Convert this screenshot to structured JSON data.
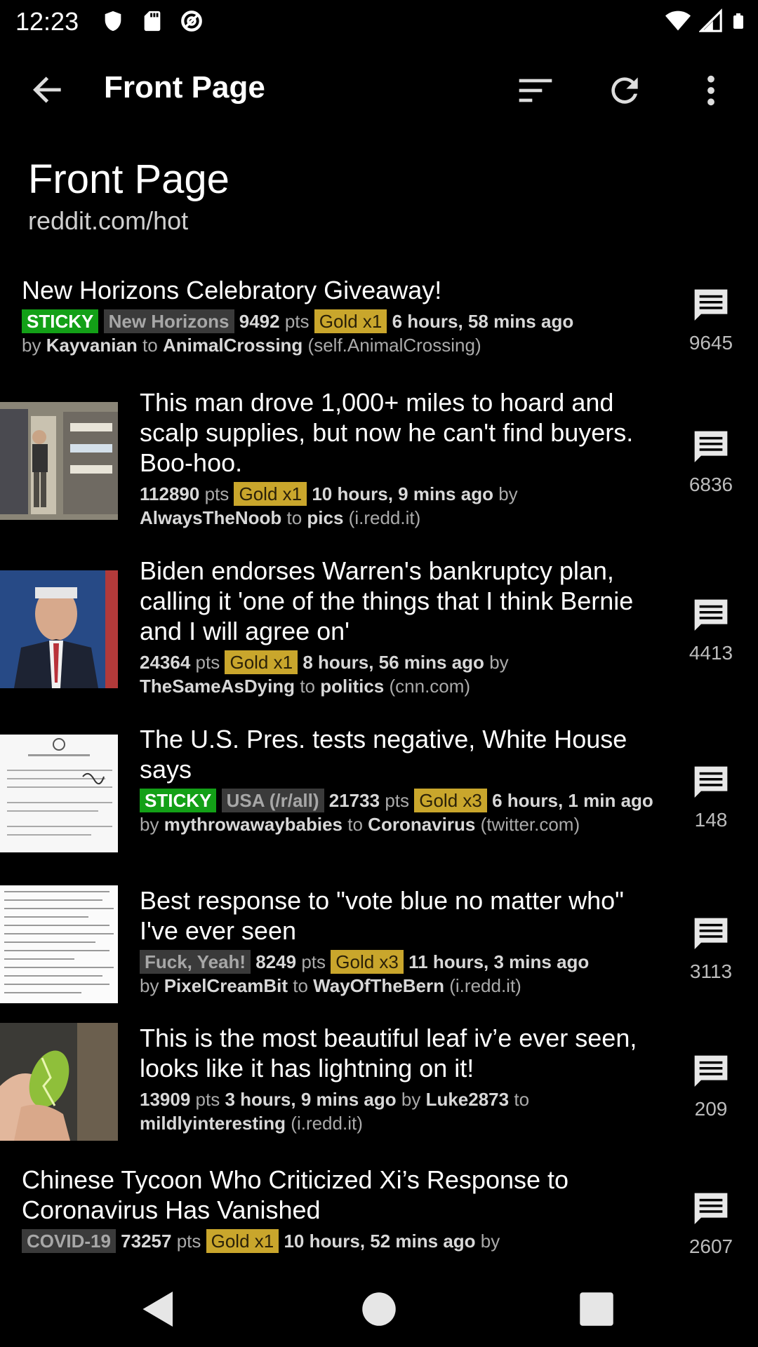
{
  "status_bar": {
    "time": "12:23"
  },
  "toolbar": {
    "title": "Front Page"
  },
  "header": {
    "title": "Front Page",
    "subtitle": "reddit.com/hot"
  },
  "posts": [
    {
      "title": "New Horizons Celebratory Giveaway!",
      "sticky": "STICKY",
      "flair": "New Horizons",
      "points": "9492",
      "pts_label": "pts",
      "gold": "Gold x1",
      "time": "6 hours, 58 mins ago",
      "by_label": "by",
      "author": "Kayvanian",
      "to_label": "to",
      "subreddit": "AnimalCrossing",
      "domain": "(self.AnimalCrossing)",
      "comments": "9645"
    },
    {
      "title": "This man drove 1,000+ miles to hoard and scalp supplies, but now he can't find buyers. Boo-hoo.",
      "points": "112890",
      "pts_label": "pts",
      "gold": "Gold x1",
      "time": "10 hours, 9 mins ago",
      "by_label": "by",
      "author": "AlwaysTheNoob",
      "to_label": "to",
      "subreddit": "pics",
      "domain": "(i.redd.it)",
      "comments": "6836"
    },
    {
      "title": "Biden endorses Warren's bankruptcy plan, calling it 'one of the things that I think Bernie and I will agree on'",
      "points": "24364",
      "pts_label": "pts",
      "gold": "Gold x1",
      "time": "8 hours, 56 mins ago",
      "by_label": "by",
      "author": "TheSameAsDying",
      "to_label": "to",
      "subreddit": "politics",
      "domain": "(cnn.com)",
      "comments": "4413"
    },
    {
      "title": "The U.S. Pres. tests negative, White House says",
      "sticky": "STICKY",
      "flair": "USA (/r/all)",
      "points": "21733",
      "pts_label": "pts",
      "gold": "Gold x3",
      "time": "6 hours, 1 min ago",
      "by_label": "by",
      "author": "mythrowawaybabies",
      "to_label": "to",
      "subreddit": "Coronavirus",
      "domain": "(twitter.com)",
      "comments": "148"
    },
    {
      "title": "Best response to \"vote blue no matter who\" I've ever seen",
      "flair": "Fuck, Yeah!",
      "points": "8249",
      "pts_label": "pts",
      "gold": "Gold x3",
      "time": "11 hours, 3 mins ago",
      "by_label": "by",
      "author": "PixelCreamBit",
      "to_label": "to",
      "subreddit": "WayOfTheBern",
      "domain": "(i.redd.it)",
      "comments": "3113"
    },
    {
      "title": "This is the most beautiful leaf iv’e ever seen, looks like it has lightning on it!",
      "points": "13909",
      "pts_label": "pts",
      "time": "3 hours, 9 mins ago",
      "by_label": "by",
      "author": "Luke2873",
      "to_label": "to",
      "subreddit": "mildlyinteresting",
      "domain": "(i.redd.it)",
      "comments": "209"
    },
    {
      "title": "Chinese Tycoon Who Criticized Xi’s Response to Coronavirus Has Vanished",
      "flair": "COVID-19",
      "points": "73257",
      "pts_label": "pts",
      "gold": "Gold x1",
      "time": "10 hours, 52 mins ago",
      "by_label": "by",
      "comments": "2607"
    }
  ],
  "colors": {
    "background": "#000000",
    "sticky": "#13a017",
    "gold": "#c9a62c",
    "flair_bg": "#3a3a3a"
  },
  "icons": {
    "toolbar": [
      "back-arrow-icon",
      "sort-icon",
      "refresh-icon",
      "more-vert-icon"
    ],
    "status": [
      "shield-icon",
      "sd-card-icon",
      "at-sign-icon",
      "wifi-icon",
      "signal-icon",
      "battery-icon"
    ],
    "nav": [
      "nav-back-icon",
      "nav-home-icon",
      "nav-recents-icon"
    ],
    "post": "comment-icon"
  }
}
